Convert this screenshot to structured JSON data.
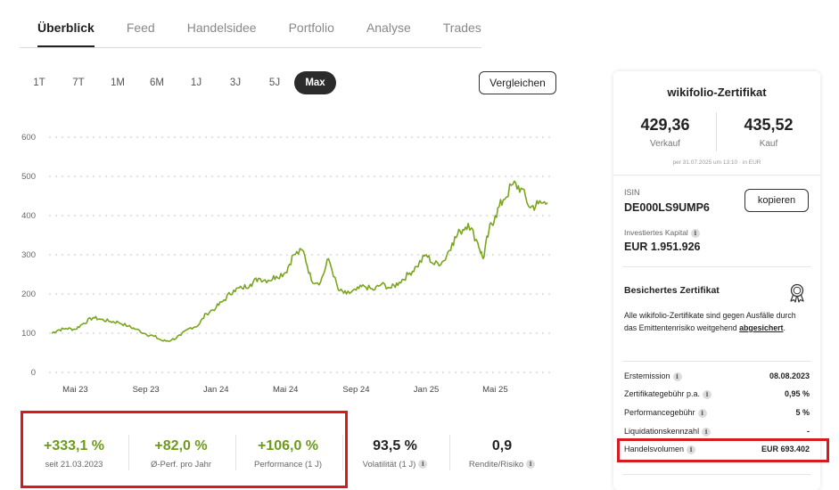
{
  "tabs": [
    {
      "label": "Überblick",
      "active": true
    },
    {
      "label": "Feed"
    },
    {
      "label": "Handelsidee"
    },
    {
      "label": "Portfolio"
    },
    {
      "label": "Analyse"
    },
    {
      "label": "Trades"
    }
  ],
  "ranges": [
    "1T",
    "7T",
    "1M",
    "6M",
    "1J",
    "3J",
    "5J",
    "Max"
  ],
  "active_range": "Max",
  "compare_label": "Vergleichen",
  "chart_data": {
    "type": "line",
    "title": "",
    "xlabel": "",
    "ylabel": "",
    "ylim": [
      0,
      600
    ],
    "y_ticks": [
      "600",
      "500",
      "400",
      "300",
      "200",
      "100",
      "0"
    ],
    "x_ticks": [
      "Mai 23",
      "Sep 23",
      "Jan 24",
      "Mai 24",
      "Sep 24",
      "Jan 25",
      "Mai 25"
    ],
    "grid": true,
    "color": "#7aa51e",
    "series": [
      {
        "x": [
          "2023-03-21",
          "2023-04-01",
          "2023-04-15",
          "2023-05-01",
          "2023-05-15",
          "2023-06-01",
          "2023-06-15",
          "2023-07-01",
          "2023-07-15",
          "2023-08-01",
          "2023-08-15",
          "2023-09-01",
          "2023-09-15",
          "2023-10-01",
          "2023-10-15",
          "2023-11-01",
          "2023-11-15",
          "2023-12-01",
          "2023-12-15",
          "2024-01-01",
          "2024-01-15",
          "2024-02-01",
          "2024-02-15",
          "2024-03-01",
          "2024-03-15",
          "2024-04-01",
          "2024-04-15",
          "2024-05-01",
          "2024-05-15",
          "2024-06-01",
          "2024-06-15",
          "2024-07-01",
          "2024-07-15",
          "2024-08-01",
          "2024-08-15",
          "2024-09-01",
          "2024-09-15",
          "2024-10-01",
          "2024-10-15",
          "2024-11-01",
          "2024-11-15",
          "2024-12-01",
          "2024-12-15",
          "2025-01-01",
          "2025-01-15",
          "2025-02-01",
          "2025-02-15",
          "2025-03-01",
          "2025-03-15",
          "2025-04-01",
          "2025-04-10",
          "2025-04-20",
          "2025-05-01",
          "2025-05-15",
          "2025-06-01",
          "2025-06-15",
          "2025-07-01",
          "2025-07-15",
          "2025-07-31"
        ],
        "values": [
          100,
          108,
          112,
          110,
          125,
          140,
          135,
          130,
          128,
          118,
          110,
          98,
          92,
          80,
          82,
          95,
          112,
          120,
          150,
          165,
          185,
          210,
          215,
          225,
          240,
          235,
          245,
          255,
          300,
          310,
          235,
          230,
          290,
          210,
          200,
          210,
          220,
          210,
          225,
          215,
          230,
          250,
          270,
          300,
          275,
          285,
          330,
          360,
          380,
          330,
          290,
          360,
          400,
          440,
          480,
          470,
          420,
          430,
          433
        ]
      }
    ]
  },
  "stats": [
    {
      "value": "+333,1 %",
      "label": "seit 21.03.2023",
      "green": true
    },
    {
      "value": "+82,0 %",
      "label": "Ø-Perf. pro Jahr",
      "green": true
    },
    {
      "value": "+106,0 %",
      "label": "Performance (1 J)",
      "green": true
    },
    {
      "value": "93,5 %",
      "label": "Volatilität (1 J)",
      "green": false
    },
    {
      "value": "0,9",
      "label": "Rendite/Risiko",
      "green": false
    }
  ],
  "panel": {
    "title": "wikifolio-Zertifikat",
    "sell_price": "429,36",
    "sell_label": "Verkauf",
    "buy_price": "435,52",
    "buy_label": "Kauf",
    "price_note": "per 31.07.2025 um 13:10 · in EUR",
    "isin_label": "ISIN",
    "isin": "DE000LS9UMP6",
    "copy_label": "kopieren",
    "capital_label": "Investiertes Kapital",
    "capital": "EUR 1.951.926",
    "secured_title": "Besichertes Zertifikat",
    "secured_text": "Alle wikifolio-Zertifikate sind gegen Ausfälle durch das Emittentenrisiko weitgehend",
    "secured_link": "abgesichert",
    "secured_end": ".",
    "rows": [
      {
        "key": "Erstemission",
        "value": "08.08.2023",
        "info": true
      },
      {
        "key": "Zertifikategebühr p.a.",
        "value": "0,95 %",
        "info": true
      },
      {
        "key": "Performancegebühr",
        "value": "5 %",
        "info": true
      },
      {
        "key": "Liquidationskennzahl",
        "value": "-",
        "info": true
      },
      {
        "key": "Handelsvolumen",
        "value": "EUR 693.402",
        "info": true
      }
    ]
  }
}
